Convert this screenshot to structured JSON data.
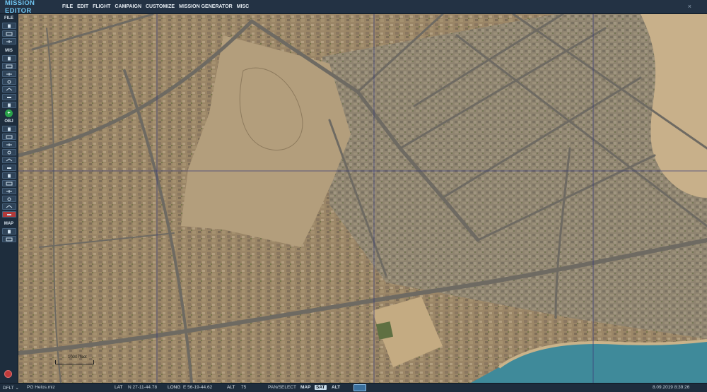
{
  "app": {
    "title": "MISSION EDITOR",
    "close_glyph": "×"
  },
  "menu": [
    "FILE",
    "EDIT",
    "FLIGHT",
    "CAMPAIGN",
    "CUSTOMIZE",
    "MISSION GENERATOR",
    "MISC"
  ],
  "toolbar": {
    "file_label": "FILE",
    "mis_label": "MIS",
    "obj_label": "OBJ",
    "map_label": "MAP",
    "file_tools": [
      "new-file-icon",
      "open-file-icon",
      "save-file-icon"
    ],
    "mis_tools": [
      "briefing-icon",
      "weather-icon",
      "trigger-icon",
      "failure-icon",
      "goals-icon",
      "resource-icon",
      "check-icon"
    ],
    "obj_tools": [
      "plane-icon",
      "helicopter-icon",
      "ship-icon",
      "ground-unit-icon",
      "static-object-icon",
      "template-icon",
      "airport-icon",
      "zone-icon",
      "nav-point-icon",
      "warehouse-icon",
      "unit-group-icon",
      "delete-icon"
    ],
    "map_tools": [
      "map-options-icon",
      "ruler-icon"
    ]
  },
  "map": {
    "scale_label": "10007feet",
    "accent": "#6fc4f0",
    "water_color": "#3f8a9a"
  },
  "status": {
    "profile": "DFLT",
    "mission_file": "PG Helos.miz",
    "lat_label": "LAT",
    "lat_value": "N 27-11-44.78",
    "long_label": "LONG",
    "long_value": "E 56-19-44.62",
    "alt_label": "ALT",
    "alt_value": "75",
    "mode_label": "PAN/SELECT",
    "map_btn": "MAP",
    "sat_btn": "SAT",
    "alt_btn": "ALT",
    "datetime": "8.09.2019 8:39:26"
  }
}
